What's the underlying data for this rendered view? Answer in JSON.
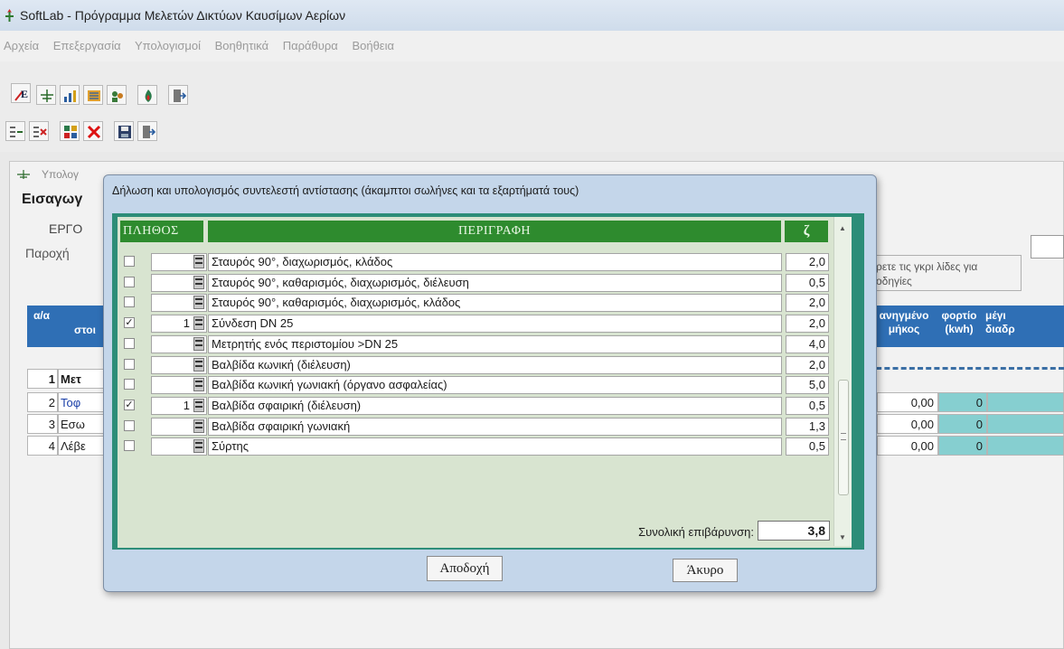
{
  "window": {
    "title": "SoftLab - Πρόγραμμα Μελετών Δικτύων Καυσίμων Αερίων"
  },
  "menu": [
    "Αρχεία",
    "Επεξεργασία",
    "Υπολογισμοί",
    "Βοηθητικά",
    "Παράθυρα",
    "Βοήθεια"
  ],
  "child": {
    "title": "Υπολογ",
    "input_label": "Εισαγωγ",
    "ergo_label": "ΕΡΓΟ",
    "paroxi_label": "Παροχή",
    "hint": "ρετε τις γκρι λίδες για οδηγίες"
  },
  "grid": {
    "headers": {
      "aa": "α/α",
      "stoixeio": "στοι",
      "anig_mikos": "ανηγμένο μήκος",
      "fortio": "φορτίο (kwh)",
      "megisti": "μέγι διαδρ"
    },
    "rows": [
      {
        "num": "1",
        "name": "Μετ",
        "mikos": "",
        "fortio": ""
      },
      {
        "num": "2",
        "name": "Τοφ",
        "mikos": "0,00",
        "fortio": "0"
      },
      {
        "num": "3",
        "name": "Εσω",
        "mikos": "0,00",
        "fortio": "0"
      },
      {
        "num": "4",
        "name": "Λέβε",
        "mikos": "0,00",
        "fortio": "0"
      }
    ]
  },
  "dialog": {
    "title": "Δήλωση και υπολογισμός συντελεστή αντίστασης (άκαμπτοι σωλήνες και τα εξαρτήματά τους)",
    "headers": {
      "plithos": "ΠΛΗΘΟΣ",
      "perigrafi": "ΠΕΡΙΓΡΑΦΗ",
      "zeta": "ζ"
    },
    "rows": [
      {
        "checked": false,
        "qty": "",
        "desc": "Σταυρός 90°, διαχωρισμός, κλάδος",
        "zeta": "2,0"
      },
      {
        "checked": false,
        "qty": "",
        "desc": "Σταυρός 90°, καθαρισμός, διαχωρισμός, διέλευση",
        "zeta": "0,5"
      },
      {
        "checked": false,
        "qty": "",
        "desc": "Σταυρός 90°, καθαρισμός, διαχωρισμός, κλάδος",
        "zeta": "2,0"
      },
      {
        "checked": true,
        "qty": "1",
        "desc": "Σύνδεση DN 25",
        "zeta": "2,0"
      },
      {
        "checked": false,
        "qty": "",
        "desc": "Μετρητής ενός περιστομίου >DN 25",
        "zeta": "4,0"
      },
      {
        "checked": false,
        "qty": "",
        "desc": "Βαλβίδα κωνική (διέλευση)",
        "zeta": "2,0"
      },
      {
        "checked": false,
        "qty": "",
        "desc": "Βαλβίδα κωνική γωνιακή (όργανο ασφαλείας)",
        "zeta": "5,0"
      },
      {
        "checked": true,
        "qty": "1",
        "desc": "Βαλβίδα σφαιρική (διέλευση)",
        "zeta": "0,5"
      },
      {
        "checked": false,
        "qty": "",
        "desc": "Βαλβίδα σφαιρική γωνιακή",
        "zeta": "1,3"
      },
      {
        "checked": false,
        "qty": "",
        "desc": "Σύρτης",
        "zeta": "0,5"
      }
    ],
    "total_label": "Συνολική επιβάρυνση:",
    "total_value": "3,8",
    "accept_label": "Αποδοχή",
    "cancel_label": "Άκυρο"
  }
}
